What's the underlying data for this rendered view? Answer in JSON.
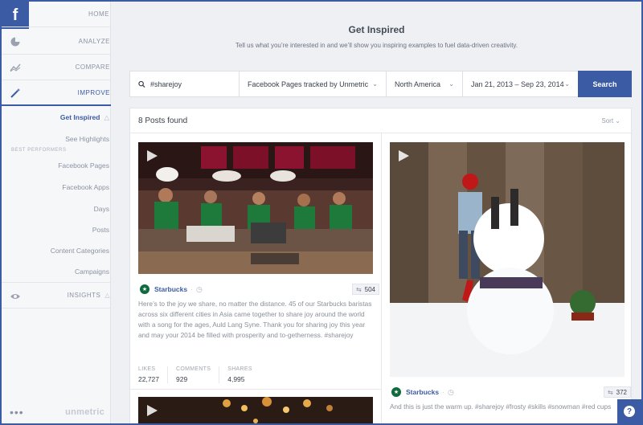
{
  "sidebar": {
    "logo": "f",
    "nav": [
      {
        "label": "HOME"
      },
      {
        "label": "ANALYZE"
      },
      {
        "label": "COMPARE"
      },
      {
        "label": "IMPROVE"
      }
    ],
    "improve_items": {
      "get_inspired": "Get Inspired",
      "see_highlights": "See Highlights"
    },
    "best_performers_label": "BEST PERFORMERS",
    "best_performers": [
      "Facebook Pages",
      "Facebook Apps",
      "Days",
      "Posts",
      "Content Categories",
      "Campaigns"
    ],
    "insights": "INSIGHTS",
    "more": "•••",
    "brand": "unmetric"
  },
  "header": {
    "title": "Get Inspired",
    "subtitle": "Tell us what you’re interested in and we’ll show you inspiring examples to fuel data-driven creativity."
  },
  "search": {
    "query": "#sharejoy",
    "pages_filter": "Facebook Pages tracked by Unmetric",
    "region": "North America",
    "date_range": "Jan 21, 2013 – Sep 23, 2014",
    "button": "Search"
  },
  "results": {
    "count_label": "8 Posts found",
    "sort_label": "Sort",
    "posts": [
      {
        "author": "Starbucks",
        "shares_badge": "504",
        "text": "Here’s to the joy we share, no matter the distance. 45 of our Starbucks baristas across six different cities in Asia came together to share joy around the world with a song for the ages, Auld Lang Syne. Thank you for sharing joy this year and may your 2014 be filled with prosperity and to-getherness. #sharejoy",
        "stats": [
          {
            "label": "LIKES",
            "value": "22,727"
          },
          {
            "label": "COMMENTS",
            "value": "929"
          },
          {
            "label": "SHARES",
            "value": "4,995"
          }
        ]
      },
      {
        "author": "Starbucks",
        "shares_badge": "372",
        "text": "And this is just the warm up. #sharejoy #frosty #skills #snowman #red cups"
      }
    ]
  },
  "colors": {
    "brand": "#3b5ba5",
    "starbucks": "#0f6b3e"
  },
  "icons": {
    "help": "?"
  }
}
